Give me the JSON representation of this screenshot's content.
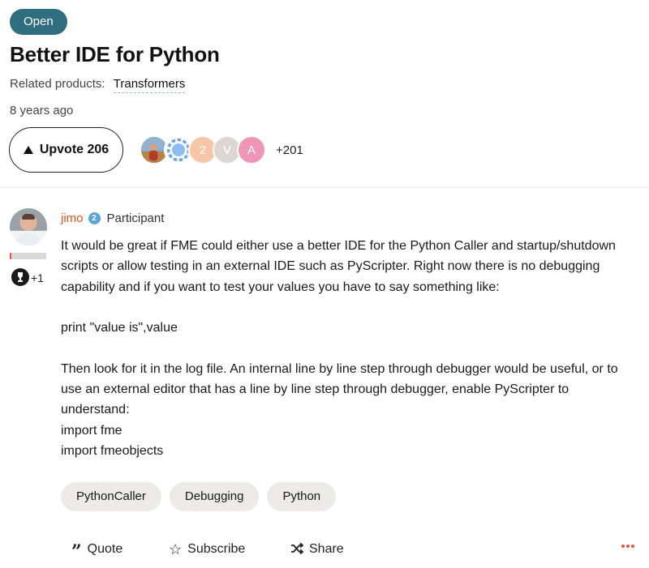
{
  "idea": {
    "status": "Open",
    "title": "Better IDE for Python",
    "related_label": "Related products:",
    "related_product": "Transformers",
    "posted": "8 years ago"
  },
  "votes": {
    "upvote_label": "Upvote 206",
    "voter_initials": [
      "2",
      "V",
      "A"
    ],
    "more_count": "+201"
  },
  "post": {
    "author": {
      "name": "jimo",
      "level": "2",
      "role": "Participant",
      "rank_progress_percent": 5,
      "extra_badges": "+1"
    },
    "paragraphs": [
      "It would be great if FME could either use a better IDE for the Python Caller and startup/shutdown scripts or allow testing in an external IDE such as PyScripter. Right now there is no debugging capability and if you want to test your values you have to say something like:",
      "print \"value is\",value",
      "Then look for it in the log file. An internal line by line step through debugger would be useful, or to use an external editor that has a line by line step through debugger, enable PyScripter to understand:",
      "import fme",
      "import fmeobjects"
    ],
    "tags": [
      "PythonCaller",
      "Debugging",
      "Python"
    ]
  },
  "actions": {
    "quote": "Quote",
    "subscribe": "Subscribe",
    "share": "Share"
  },
  "colors": {
    "status_badge": "#2f6e7e",
    "author_link": "#e0531f",
    "accent": "#e8563a"
  },
  "icons": {
    "upvote": "triangle-up-icon",
    "quote": "quote-icon",
    "subscribe": "star-icon",
    "share": "shuffle-icon",
    "more": "more-dots-icon"
  }
}
